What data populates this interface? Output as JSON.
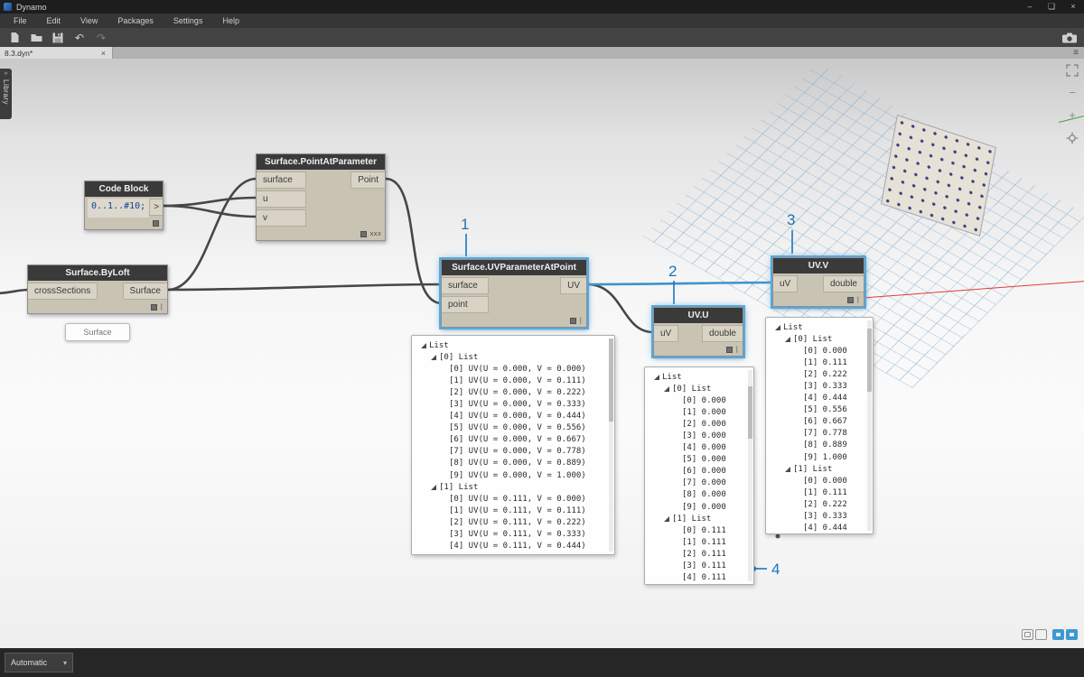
{
  "titlebar": {
    "app_name": "Dynamo"
  },
  "menubar": {
    "items": [
      {
        "label": "File"
      },
      {
        "label": "Edit"
      },
      {
        "label": "View"
      },
      {
        "label": "Packages"
      },
      {
        "label": "Settings"
      },
      {
        "label": "Help"
      }
    ]
  },
  "tabs": {
    "active_label": "8.3.dyn*"
  },
  "library": {
    "label": "Library",
    "expand_arrow": "»"
  },
  "icons": {
    "minimize": "–",
    "maximize": "❏",
    "close": "×",
    "tab_close": "×",
    "overflow_menu": "≡",
    "undo": "↶",
    "redo": "↷",
    "zoom_in": "+",
    "zoom_out": "−",
    "caret_down": "▾"
  },
  "colors": {
    "selection_blue": "#56a8dd",
    "wire_blue": "#3f93cc",
    "annotation_blue": "#1b75bb",
    "node_body": "#c9c3b4",
    "node_header": "#3a3a3a",
    "grid_blue": "#80acce",
    "axis_red": "#df3c31",
    "axis_green": "#3fa23f",
    "point_dot": "#3d3d80"
  },
  "canvas": {
    "nodes": {
      "code_block": {
        "title": "Code Block",
        "code": "0..1..#10;",
        "output": ">"
      },
      "surface_point_at_parameter": {
        "title": "Surface.PointAtParameter",
        "inputs": [
          "surface",
          "u",
          "v"
        ],
        "output": "Point",
        "lacing": "xxx"
      },
      "surface_by_loft": {
        "title": "Surface.ByLoft",
        "inputs": [
          "crossSections"
        ],
        "output": "Surface",
        "lacing": "|",
        "preview_label": "Surface"
      },
      "surface_uv_parameter_at_point": {
        "title": "Surface.UVParameterAtPoint",
        "inputs": [
          "surface",
          "point"
        ],
        "output": "UV",
        "lacing": "|"
      },
      "uv_u": {
        "title": "UV.U",
        "inputs": [
          "uV"
        ],
        "output": "double",
        "lacing": "|"
      },
      "uv_v": {
        "title": "UV.V",
        "inputs": [
          "uV"
        ],
        "output": "double",
        "lacing": "|"
      }
    },
    "watch_uvparam": {
      "rows": [
        {
          "text": "List",
          "level": 0,
          "expand": true
        },
        {
          "text": "[0] List",
          "level": 1,
          "expand": true
        },
        {
          "text": "[0] UV(U = 0.000, V = 0.000)",
          "level": 2
        },
        {
          "text": "[1] UV(U = 0.000, V = 0.111)",
          "level": 2
        },
        {
          "text": "[2] UV(U = 0.000, V = 0.222)",
          "level": 2
        },
        {
          "text": "[3] UV(U = 0.000, V = 0.333)",
          "level": 2
        },
        {
          "text": "[4] UV(U = 0.000, V = 0.444)",
          "level": 2
        },
        {
          "text": "[5] UV(U = 0.000, V = 0.556)",
          "level": 2
        },
        {
          "text": "[6] UV(U = 0.000, V = 0.667)",
          "level": 2
        },
        {
          "text": "[7] UV(U = 0.000, V = 0.778)",
          "level": 2
        },
        {
          "text": "[8] UV(U = 0.000, V = 0.889)",
          "level": 2
        },
        {
          "text": "[9] UV(U = 0.000, V = 1.000)",
          "level": 2
        },
        {
          "text": "[1] List",
          "level": 1,
          "expand": true
        },
        {
          "text": "[0] UV(U = 0.111, V = 0.000)",
          "level": 2
        },
        {
          "text": "[1] UV(U = 0.111, V = 0.111)",
          "level": 2
        },
        {
          "text": "[2] UV(U = 0.111, V = 0.222)",
          "level": 2
        },
        {
          "text": "[3] UV(U = 0.111, V = 0.333)",
          "level": 2
        },
        {
          "text": "[4] UV(U = 0.111, V = 0.444)",
          "level": 2
        }
      ]
    },
    "watch_uvu": {
      "rows": [
        {
          "text": "List",
          "level": 0,
          "expand": true
        },
        {
          "text": "[0] List",
          "level": 1,
          "expand": true
        },
        {
          "text": "[0] 0.000",
          "level": 2
        },
        {
          "text": "[1] 0.000",
          "level": 2
        },
        {
          "text": "[2] 0.000",
          "level": 2
        },
        {
          "text": "[3] 0.000",
          "level": 2
        },
        {
          "text": "[4] 0.000",
          "level": 2
        },
        {
          "text": "[5] 0.000",
          "level": 2
        },
        {
          "text": "[6] 0.000",
          "level": 2
        },
        {
          "text": "[7] 0.000",
          "level": 2
        },
        {
          "text": "[8] 0.000",
          "level": 2
        },
        {
          "text": "[9] 0.000",
          "level": 2
        },
        {
          "text": "[1] List",
          "level": 1,
          "expand": true
        },
        {
          "text": "[0] 0.111",
          "level": 2
        },
        {
          "text": "[1] 0.111",
          "level": 2
        },
        {
          "text": "[2] 0.111",
          "level": 2
        },
        {
          "text": "[3] 0.111",
          "level": 2
        },
        {
          "text": "[4] 0.111",
          "level": 2
        }
      ]
    },
    "watch_uvv": {
      "rows": [
        {
          "text": "List",
          "level": 0,
          "expand": true
        },
        {
          "text": "[0] List",
          "level": 1,
          "expand": true
        },
        {
          "text": "[0] 0.000",
          "level": 2
        },
        {
          "text": "[1] 0.111",
          "level": 2
        },
        {
          "text": "[2] 0.222",
          "level": 2
        },
        {
          "text": "[3] 0.333",
          "level": 2
        },
        {
          "text": "[4] 0.444",
          "level": 2
        },
        {
          "text": "[5] 0.556",
          "level": 2
        },
        {
          "text": "[6] 0.667",
          "level": 2
        },
        {
          "text": "[7] 0.778",
          "level": 2
        },
        {
          "text": "[8] 0.889",
          "level": 2
        },
        {
          "text": "[9] 1.000",
          "level": 2
        },
        {
          "text": "[1] List",
          "level": 1,
          "expand": true
        },
        {
          "text": "[0] 0.000",
          "level": 2
        },
        {
          "text": "[1] 0.111",
          "level": 2
        },
        {
          "text": "[2] 0.222",
          "level": 2
        },
        {
          "text": "[3] 0.333",
          "level": 2
        },
        {
          "text": "[4] 0.444",
          "level": 2
        }
      ]
    },
    "annotations": {
      "n1": "1",
      "n2": "2",
      "n3": "3",
      "n4": "4"
    }
  },
  "statusbar": {
    "run_mode": "Automatic"
  }
}
